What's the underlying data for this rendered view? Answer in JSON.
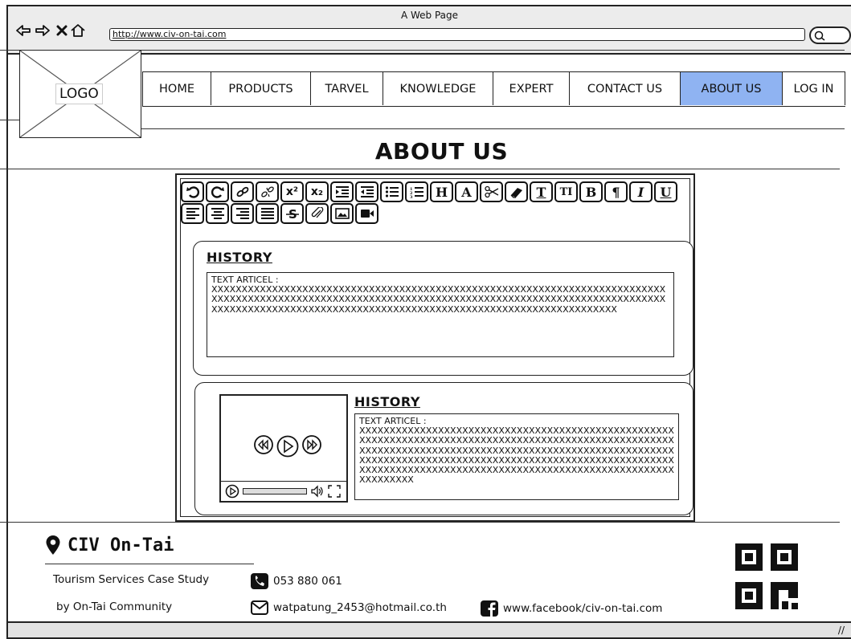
{
  "window": {
    "title": "A Web Page",
    "url": "http://www.civ-on-tai.com"
  },
  "logo": {
    "label": "LOGO"
  },
  "menu": [
    {
      "label": "HOME",
      "active": false
    },
    {
      "label": "PRODUCTS",
      "active": false
    },
    {
      "label": "TARVEL",
      "active": false
    },
    {
      "label": "KNOWLEDGE",
      "active": false
    },
    {
      "label": "EXPERT",
      "active": false
    },
    {
      "label": "CONTACT US",
      "active": false
    },
    {
      "label": "ABOUT US",
      "active": true
    },
    {
      "label": "LOG IN",
      "active": false
    }
  ],
  "page": {
    "title": "ABOUT US"
  },
  "toolbar": {
    "superscript": "x²",
    "subscript": "x₂",
    "heading": "H",
    "font": "A",
    "bold": "B",
    "paragraph": "¶",
    "italic": "I",
    "underline": "U",
    "text_T": "T",
    "text_TT": "TI"
  },
  "sections": [
    {
      "heading": "HISTORY",
      "label": "TEXT ARTICEL :",
      "body": "XXXXXXXXXXXXXXXXXXXXXXXXXXXXXXXXXXXXXXXXXXXXXXXXXXXXXXXXXXXXXXXXXXXXXXXXXXXXXXXXXXXXXXXXXXXXXXXXXXXXXXXXXXXXXXXXXXXXXXXXXXXXXXXXXXXXXXXXXXXXXXXXXXXXXXXXXXXXXXXXXXXXXXXXXXXXXXXXXXXXXXXXXXXXXXXXXXXXXXXXXXXXXXXXXXXXXXXXX"
    },
    {
      "heading": "HISTORY",
      "label": "TEXT ARTICEL :",
      "body": "XXXXXXXXXXXXXXXXXXXXXXXXXXXXXXXXXXXXXXXXXXXXXXXXXXXXXXXXXXXXXXXXXXXXXXXXXXXXXXXXXXXXXXXXXXXXXXXXXXXXXXXXXXXXXXXXXXXXXXXXXXXXXXXXXXXXXXXXXXXXXXXXXXXXXXXXXXXXXXXXXXXXXXXXXXXXXXXXXXXXXXXXXXXXXXXXXXXXXXXXXXXXXXXXXXXXXXXXXXXXXXXXXXXXXXXXXXXXXXXXXXXXXXXXXXXXXXXXXXXXXXXXXXXXX"
    }
  ],
  "footer": {
    "brand": "CIV On-Tai",
    "line1": "Tourism Services Case Study",
    "line2": "by On-Tai Community",
    "phone": "053 880 061",
    "email": "watpatung_2453@hotmail.co.th",
    "facebook": "www.facebook/civ-on-tai.com"
  },
  "colors": {
    "active_menu": "#8fb3f2"
  }
}
